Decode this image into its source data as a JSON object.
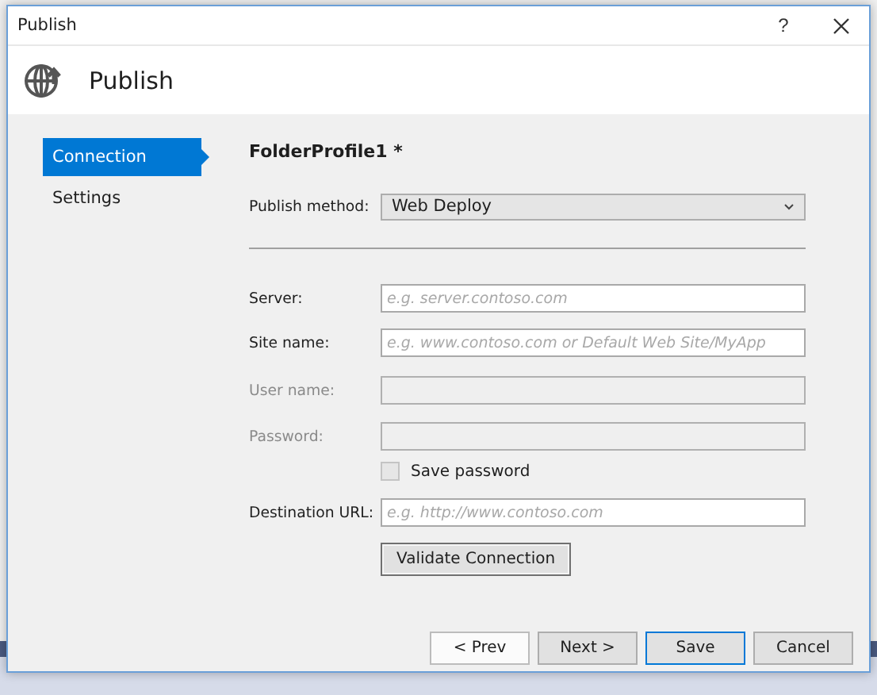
{
  "window": {
    "title": "Publish",
    "help": "?"
  },
  "header": {
    "title": "Publish"
  },
  "sidebar": {
    "items": [
      {
        "label": "Connection",
        "selected": true
      },
      {
        "label": "Settings",
        "selected": false
      }
    ]
  },
  "profile": {
    "title": "FolderProfile1 *"
  },
  "publish_method": {
    "label": "Publish method:",
    "value": "Web Deploy"
  },
  "fields": [
    {
      "kind": "text",
      "label": "Server:",
      "placeholder": "e.g. server.contoso.com",
      "disabled": false
    },
    {
      "kind": "text",
      "label": "Site name:",
      "placeholder": "e.g. www.contoso.com or Default Web Site/MyApp",
      "disabled": false
    },
    {
      "kind": "text",
      "label": "User name:",
      "disabled": true
    },
    {
      "kind": "text",
      "label": "Password:",
      "disabled": true
    },
    {
      "kind": "checkbox",
      "label": "Save password",
      "checked": false,
      "disabled": true
    },
    {
      "kind": "text",
      "label": "Destination URL:",
      "placeholder": "e.g. http://www.contoso.com",
      "disabled": false
    }
  ],
  "validate_button": "Validate Connection",
  "buttons": [
    {
      "label": "< Prev",
      "kind": "plain"
    },
    {
      "label": "Next >",
      "kind": "normal"
    },
    {
      "label": "Save",
      "kind": "default"
    },
    {
      "label": "Cancel",
      "kind": "normal"
    }
  ]
}
